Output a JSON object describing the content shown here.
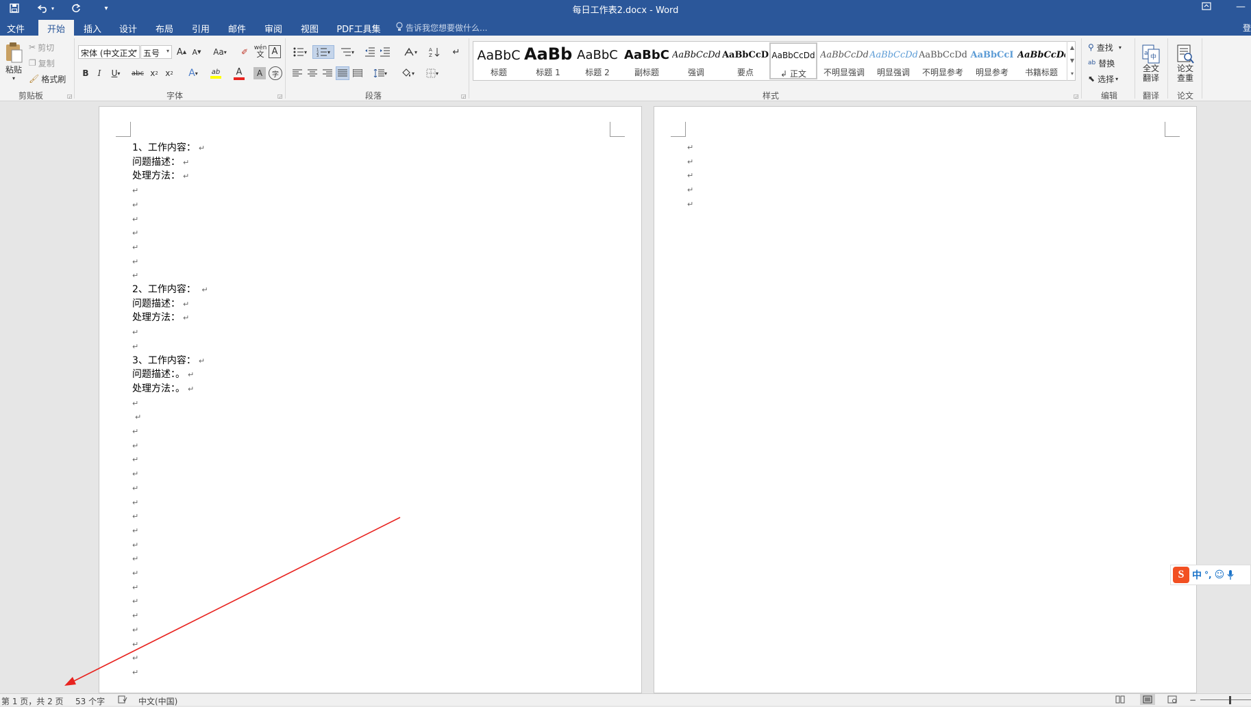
{
  "titlebar": {
    "title": "每日工作表2.docx - Word"
  },
  "tabs": [
    {
      "label": "文件"
    },
    {
      "label": "开始"
    },
    {
      "label": "插入"
    },
    {
      "label": "设计"
    },
    {
      "label": "布局"
    },
    {
      "label": "引用"
    },
    {
      "label": "邮件"
    },
    {
      "label": "审阅"
    },
    {
      "label": "视图"
    },
    {
      "label": "PDF工具集"
    }
  ],
  "tellme": "告诉我您想要做什么...",
  "login": "登",
  "clipboard": {
    "paste": "粘贴",
    "cut": "剪切",
    "copy": "复制",
    "format_painter": "格式刷",
    "group": "剪贴板"
  },
  "font": {
    "name": "宋体 (中文正文",
    "size": "五号",
    "group": "字体",
    "grow": "A",
    "shrink": "A",
    "case": "Aa",
    "bold": "B",
    "italic": "I",
    "underline": "U",
    "strike": "abc",
    "subscript": "x",
    "superscript": "x",
    "phonetic_top": "wén",
    "phonetic_bottom": "文",
    "border_char": "A",
    "shade_char": "A",
    "circle_char": "字",
    "effects": "A",
    "highlight": "ab",
    "fontcolor": "A"
  },
  "paragraph": {
    "group": "段落"
  },
  "styles": {
    "group": "样式",
    "items": [
      {
        "sample": "AaBbC",
        "name": "标题"
      },
      {
        "sample": "AaBb",
        "name": "标题 1"
      },
      {
        "sample": "AaBbC",
        "name": "标题 2"
      },
      {
        "sample": "AaBbC",
        "name": "副标题"
      },
      {
        "sample": "AaBbCcDd",
        "name": "强调"
      },
      {
        "sample": "AaBbCcD",
        "name": "要点"
      },
      {
        "sample": "AaBbCcDd",
        "name": "正文"
      },
      {
        "sample": "AaBbCcDd",
        "name": "不明显强调"
      },
      {
        "sample": "AaBbCcDd",
        "name": "明显强调"
      },
      {
        "sample": "AaBbCcDd",
        "name": "不明显参考"
      },
      {
        "sample": "AaBbCcI",
        "name": "明显参考"
      },
      {
        "sample": "AaBbCcDd",
        "name": "书籍标题"
      }
    ],
    "selected_marker": "↲"
  },
  "editing": {
    "find": "查找",
    "replace": "替换",
    "select": "选择",
    "group": "编辑"
  },
  "translate": {
    "line1": "全文",
    "line2": "翻译",
    "group": "翻译"
  },
  "thesis": {
    "line1": "论文",
    "line2": "查重",
    "group": "论文"
  },
  "page1": {
    "lines": [
      {
        "text": "1、工作内容：",
        "mark": "↵"
      },
      {
        "text": "问题描述：",
        "mark": "↵"
      },
      {
        "text": "处理方法：",
        "mark": "↵"
      },
      {
        "text": "",
        "mark": "↵"
      },
      {
        "text": "",
        "mark": "↵"
      },
      {
        "text": "",
        "mark": "↵"
      },
      {
        "text": "",
        "mark": "↵"
      },
      {
        "text": "",
        "mark": "↵"
      },
      {
        "text": "",
        "mark": "↵"
      },
      {
        "text": "",
        "mark": "↵"
      },
      {
        "text": "2、工作内容： ",
        "mark": "↵"
      },
      {
        "text": "问题描述：",
        "mark": "↵"
      },
      {
        "text": "处理方法：",
        "mark": "↵"
      },
      {
        "text": "",
        "mark": "↵"
      },
      {
        "text": "",
        "mark": "↵"
      },
      {
        "text": "3、工作内容：",
        "mark": "↵"
      },
      {
        "text": "问题描述：。",
        "mark": "↵"
      },
      {
        "text": "处理方法：。",
        "mark": "↵"
      },
      {
        "text": "",
        "mark": "↵"
      },
      {
        "text": " ",
        "mark": "↵"
      },
      {
        "text": "",
        "mark": "↵"
      },
      {
        "text": "",
        "mark": "↵"
      },
      {
        "text": "",
        "mark": "↵"
      },
      {
        "text": "",
        "mark": "↵"
      },
      {
        "text": "",
        "mark": "↵"
      },
      {
        "text": "",
        "mark": "↵"
      },
      {
        "text": "",
        "mark": "↵"
      },
      {
        "text": "",
        "mark": "↵"
      },
      {
        "text": "",
        "mark": "↵"
      },
      {
        "text": "",
        "mark": "↵"
      },
      {
        "text": "",
        "mark": "↵"
      },
      {
        "text": "",
        "mark": "↵"
      },
      {
        "text": "",
        "mark": "↵"
      },
      {
        "text": "",
        "mark": "↵"
      },
      {
        "text": "",
        "mark": "↵"
      },
      {
        "text": "",
        "mark": "↵"
      },
      {
        "text": "",
        "mark": "↵"
      },
      {
        "text": "",
        "mark": "↵"
      }
    ]
  },
  "page2": {
    "lines": [
      {
        "mark": "↵"
      },
      {
        "mark": "↵"
      },
      {
        "mark": "↵"
      },
      {
        "mark": "↵"
      },
      {
        "mark": "↵"
      }
    ]
  },
  "ime": {
    "logo": "S",
    "mode": "中",
    "punct": "°,",
    "emoji": "☺",
    "mic": "🎤"
  },
  "statusbar": {
    "page": "第 1 页，共 2 页",
    "words": "53 个字",
    "language": "中文(中国)"
  },
  "colors": {
    "brand": "#2b579a",
    "annotation_arrow": "#e8231f",
    "font_color_bar": "#e8231f",
    "highlight_bar": "#ffff00"
  }
}
